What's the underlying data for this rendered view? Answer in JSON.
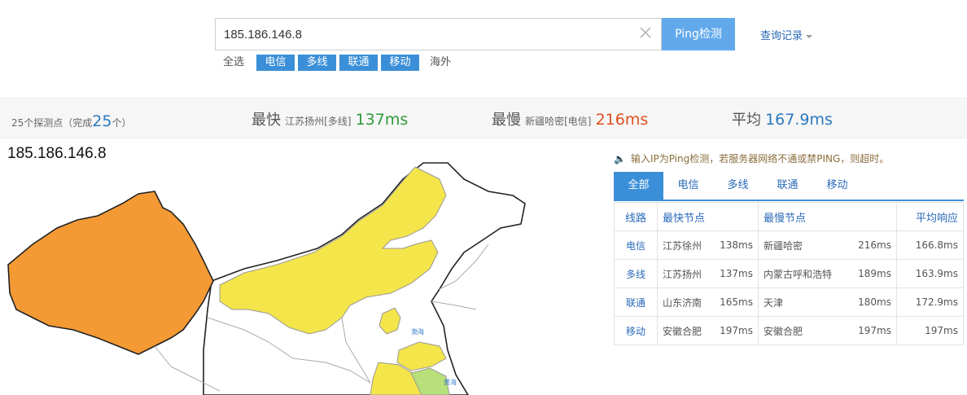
{
  "search": {
    "value": "185.186.146.8",
    "button_label": "Ping检测",
    "history_label": "查询记录"
  },
  "filters": {
    "all": "全选",
    "tags": [
      "电信",
      "多线",
      "联通",
      "移动"
    ],
    "overseas": "海外"
  },
  "stats": {
    "points_prefix": "25个探测点（完成",
    "points_done": "25",
    "points_suffix": "个）",
    "fastest_label": "最快",
    "fastest_node": "江苏扬州[多线]",
    "fastest_ms": "137ms",
    "slowest_label": "最慢",
    "slowest_node": "新疆哈密[电信]",
    "slowest_ms": "216ms",
    "avg_label": "平均",
    "avg_ms": "167.9ms"
  },
  "map": {
    "ip": "185.186.146.8",
    "sea_label_1": "渤海",
    "sea_label_2": "黄海"
  },
  "notice": "输入IP为Ping检测，若服务器网络不通或禁PING，则超时。",
  "tabs": [
    "全部",
    "电信",
    "多线",
    "联通",
    "移动"
  ],
  "table": {
    "headers": [
      "线路",
      "最快节点",
      "最慢节点",
      "平均响应"
    ],
    "rows": [
      {
        "line": "电信",
        "fast": "江苏徐州",
        "fast_ms": "138ms",
        "slow": "新疆哈密",
        "slow_ms": "216ms",
        "avg": "166.8ms"
      },
      {
        "line": "多线",
        "fast": "江苏扬州",
        "fast_ms": "137ms",
        "slow": "内蒙古呼和浩特",
        "slow_ms": "189ms",
        "avg": "163.9ms"
      },
      {
        "line": "联通",
        "fast": "山东济南",
        "fast_ms": "165ms",
        "slow": "天津",
        "slow_ms": "180ms",
        "avg": "172.9ms"
      },
      {
        "line": "移动",
        "fast": "安徽合肥",
        "fast_ms": "197ms",
        "slow": "安徽合肥",
        "slow_ms": "197ms",
        "avg": "197ms"
      }
    ]
  },
  "colors": {
    "accent": "#3b8fd8",
    "xinjiang": "#f39a35",
    "yellow": "#f4e54a",
    "green": "#b7e07a"
  }
}
